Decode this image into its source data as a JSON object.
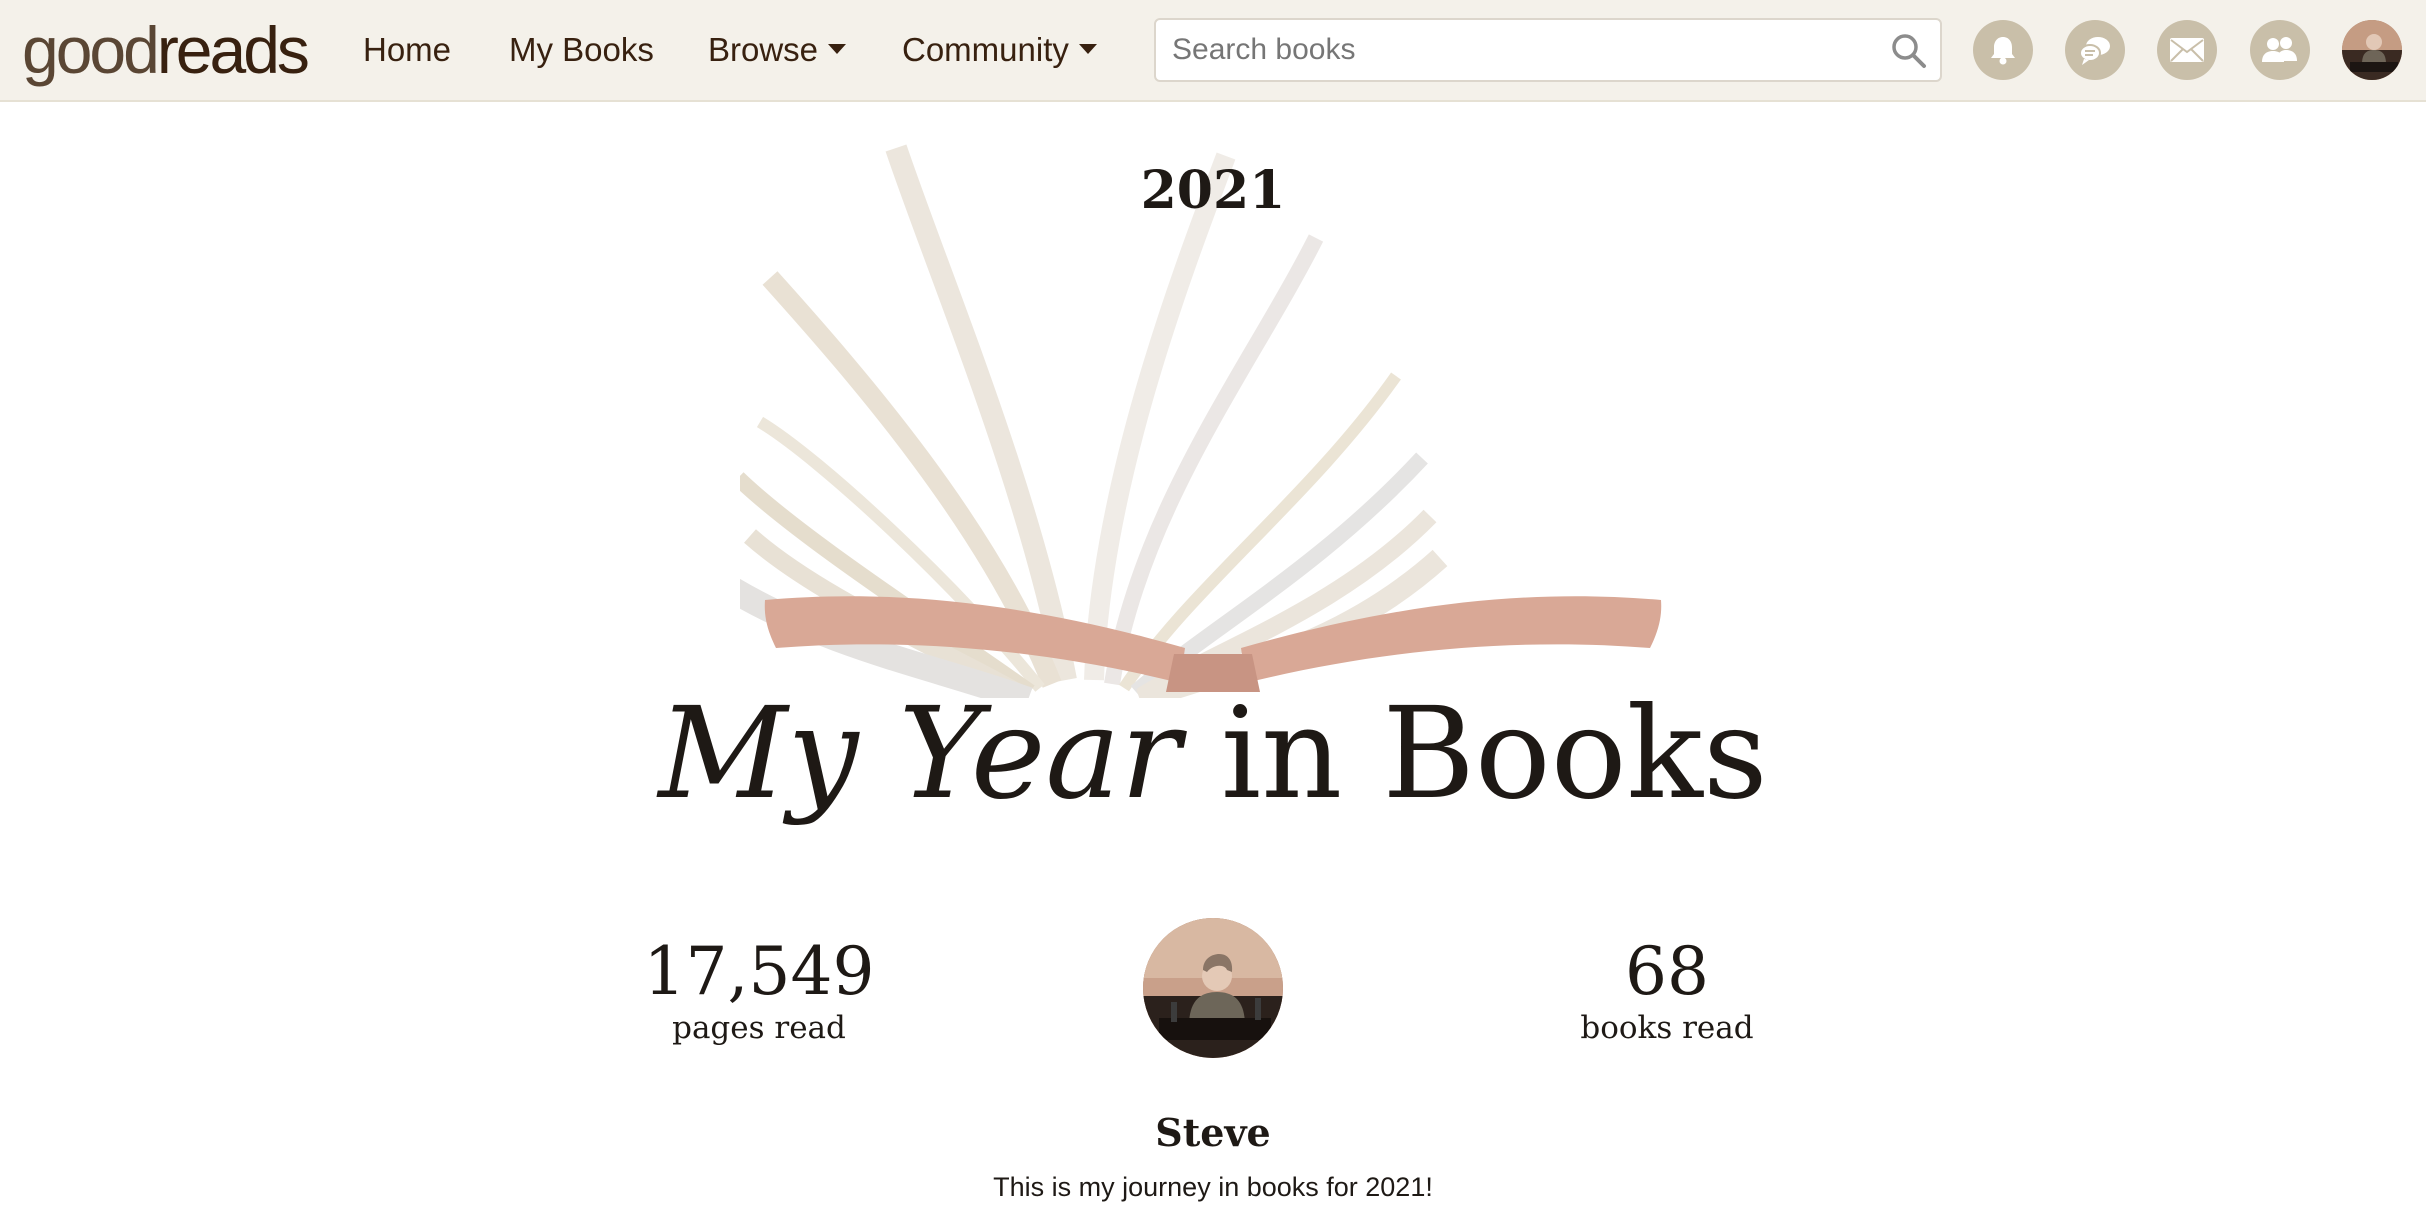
{
  "header": {
    "logo": {
      "light": "good",
      "bold": "reads"
    },
    "nav": [
      {
        "label": "Home"
      },
      {
        "label": "My Books"
      },
      {
        "label": "Browse"
      },
      {
        "label": "Community"
      }
    ],
    "search": {
      "placeholder": "Search books",
      "value": ""
    },
    "icons": [
      "bell-icon",
      "chat-icon",
      "mail-icon",
      "friends-icon"
    ]
  },
  "hero": {
    "year": "2021",
    "title_italic": "My Year",
    "title_rest": " in Books"
  },
  "stats": {
    "pages": {
      "value": "17,549",
      "label": "pages read"
    },
    "books": {
      "value": "68",
      "label": "books read"
    }
  },
  "profile": {
    "name": "Steve",
    "tagline": "This is my journey in books for 2021!"
  },
  "colors": {
    "header_bg": "#f4f1ea",
    "brand_brown": "#382110",
    "icon_circle": "#c9bfa9",
    "book_cover": "#d9a896",
    "page_beige": "#e9e2d6"
  }
}
